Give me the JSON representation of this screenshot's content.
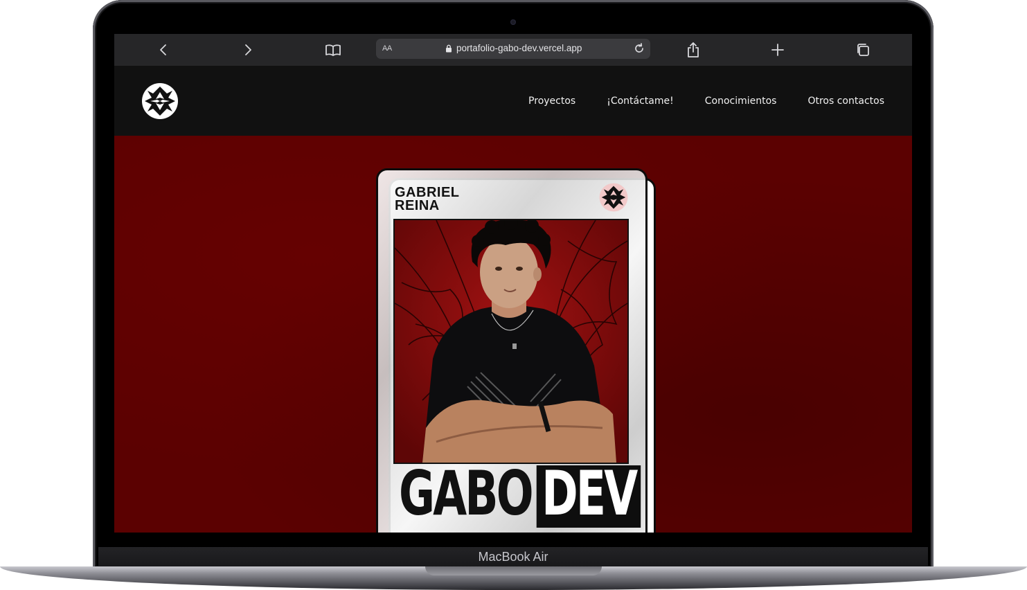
{
  "browser": {
    "url": "portafolio-gabo-dev.vercel.app",
    "reader_label": "AA",
    "icons": [
      "back-icon",
      "forward-icon",
      "book-icon",
      "lock-icon",
      "reload-icon",
      "share-icon",
      "plus-icon",
      "tabs-icon"
    ]
  },
  "nav": {
    "logo_icon": "spider-logo-icon",
    "links": [
      "Proyectos",
      "¡Contáctame!",
      "Conocimientos",
      "Otros contactos"
    ]
  },
  "hero": {
    "card_first_name": "GABRIEL",
    "card_last_name": "REINA",
    "title_word_1": "GABO",
    "title_word_2": "DEV",
    "background_color": "#5b0101"
  },
  "device": {
    "label": "MacBook Air"
  }
}
